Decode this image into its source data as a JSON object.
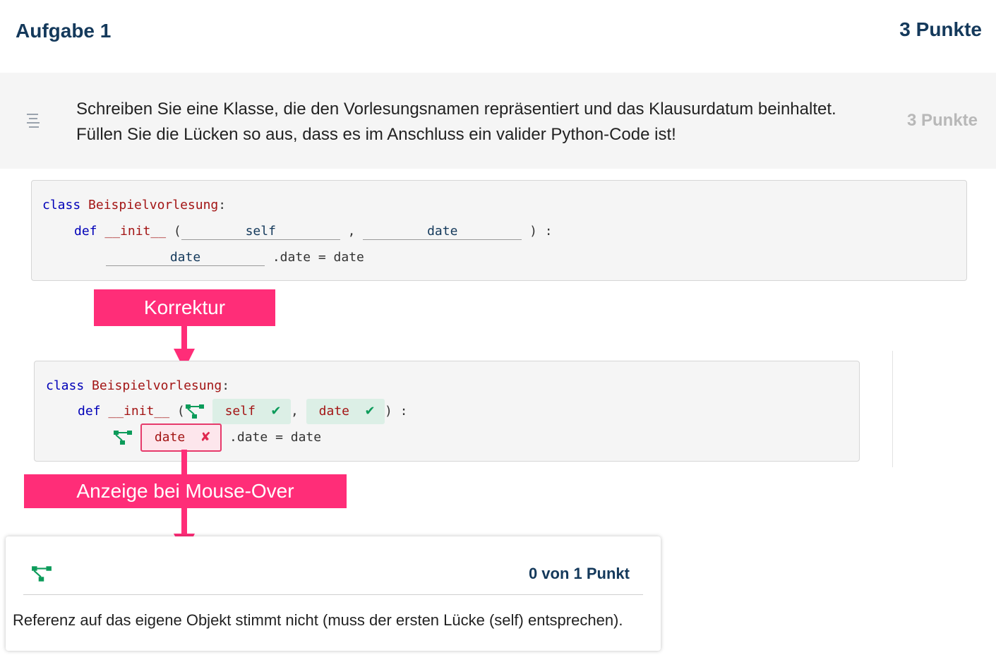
{
  "header": {
    "title": "Aufgabe 1",
    "points": "3 Punkte"
  },
  "question": {
    "text": "Schreiben Sie eine Klasse, die den Vorlesungsnamen repräsentiert und das Klausurdatum beinhaltet. Füllen Sie die Lücken so aus, dass es im Anschluss ein valider Python-Code ist!",
    "points": "3 Punkte",
    "icon": "text-lines-icon"
  },
  "code": {
    "kw_class": "class",
    "class_name": "Beispielvorlesung",
    "colon": ":",
    "kw_def": "def",
    "fn_name": "__init__",
    "open_paren": "(",
    "comma": ",",
    "close": ") :",
    "line3_rest": ".date = date",
    "blanks": [
      "self",
      "date",
      "date"
    ]
  },
  "annotations": {
    "correction": "Korrektur",
    "mouseover": "Anzeige bei Mouse-Over"
  },
  "corrected": {
    "answers": [
      {
        "value": "self",
        "status": "correct",
        "mark": "✔"
      },
      {
        "value": "date",
        "status": "correct",
        "mark": "✔"
      },
      {
        "value": "date",
        "status": "wrong",
        "mark": "✘"
      }
    ]
  },
  "popup": {
    "icon": "tree-structure-icon",
    "points": "0 von 1 Punkt",
    "feedback": "Referenz auf das eigene Objekt stimmt nicht (muss der ersten Lücke (self) entsprechen)."
  },
  "colors": {
    "accent": "#ff2d78",
    "title": "#14395b",
    "correct": "#0c9b5a",
    "wrong": "#e0284f"
  }
}
